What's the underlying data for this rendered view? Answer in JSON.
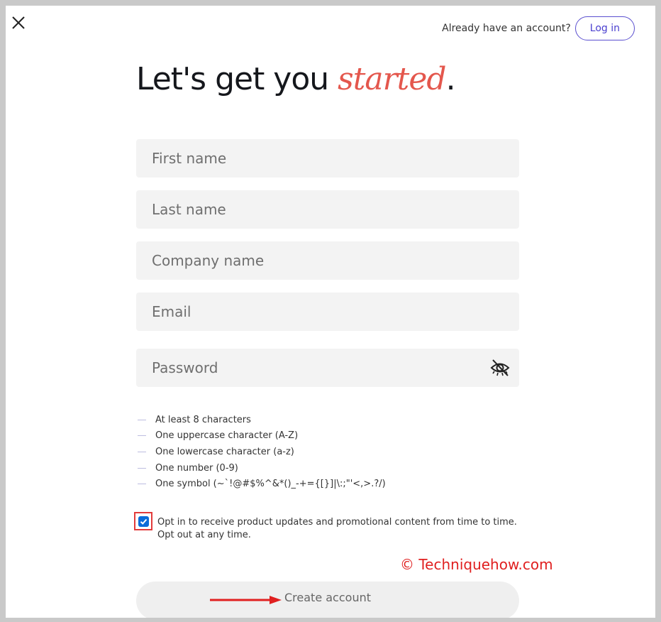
{
  "header": {
    "close_icon": "close-icon",
    "already_text": "Already have an account?",
    "login_label": "Log in"
  },
  "title": {
    "part1": "Let's get you ",
    "accent": "started",
    "period": ".",
    "accent_color": "#e4574d"
  },
  "form": {
    "first_name_placeholder": "First name",
    "last_name_placeholder": "Last name",
    "company_placeholder": "Company name",
    "email_placeholder": "Email",
    "password_placeholder": "Password",
    "password_toggle_icon": "eye-slash-icon"
  },
  "password_rules": [
    "At least 8 characters",
    "One uppercase character (A-Z)",
    "One lowercase character (a-z)",
    "One number (0-9)",
    "One symbol (~`!@#$%^&*()_-+={[}]|\\:;\"'<,>.?/)"
  ],
  "optin": {
    "checked": true,
    "line1": "Opt in to receive product updates and promotional content from time to time.",
    "line2": "Opt out at any time."
  },
  "watermark": "© Techniquehow.com",
  "create_account_label": "Create account",
  "colors": {
    "brand": "#4a3fcf",
    "checkbox": "#0b6cd9",
    "annotation": "#e02020"
  }
}
